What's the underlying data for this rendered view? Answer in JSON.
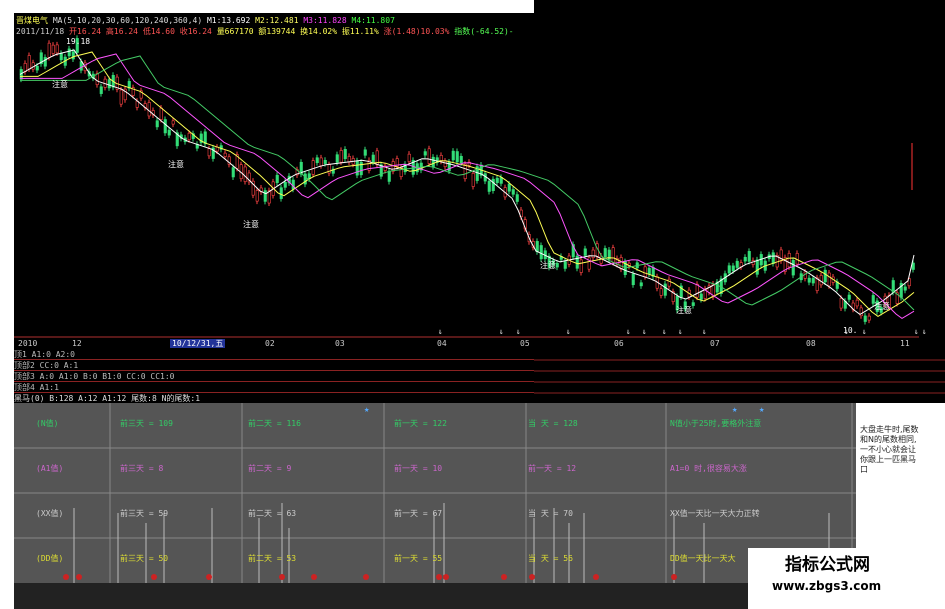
{
  "header": {
    "line1": {
      "name": "晋煤电气",
      "ma": "MA(5,10,20,30,60,120,240,360,4)",
      "m1": "M1:13.692",
      "m2": "M2:12.481",
      "m3": "M3:11.828",
      "m4": "M4:11.807"
    },
    "line2": {
      "date": "2011/11/18",
      "open": "开16.24",
      "high": "高16.24",
      "low": "低14.60",
      "close": "收16.24",
      "vol": "量667170",
      "amt": "额139744",
      "chg": "换14.02%",
      "amp": "振11.11%",
      "rise": "涨(1.48)10.03%",
      "index": "指数(-64.52)-"
    }
  },
  "chart_labels": {
    "price_high": "19.18",
    "price_low": "10.",
    "marks": [
      "注意",
      "注意",
      "注意",
      "注意",
      "注意",
      "注意"
    ]
  },
  "time_axis": {
    "labels": [
      "2010",
      "12",
      "10/12/31,五",
      "02",
      "03",
      "04",
      "05",
      "06",
      "07",
      "08",
      "11"
    ]
  },
  "indicators": [
    "顶1 A1:0 A2:0",
    "顶部2 CC:0 A:1",
    "顶部3 A:0 A1:0 B:0 B1:0 CC:0 CC1:0",
    "顶部4 A1:1",
    "黑马(0) B:128 A:12 A1:12 尾数:8 N的尾数:1"
  ],
  "table": {
    "rows": [
      {
        "head": "(N值)",
        "c1": "前三天 = 109",
        "c2": "前二天 = 116",
        "c3": "前一天 = 122",
        "c4": "当 天 = 128",
        "note": "N值小于25时,要格外注意",
        "color": "#33cc66"
      },
      {
        "head": "(A1值)",
        "c1": "前三天 = 8",
        "c2": "前二天 = 9",
        "c3": "前一天 = 10",
        "c4": "前一天 = 12",
        "note": "A1=0 时,很容易大涨",
        "color": "#cc66cc"
      },
      {
        "head": "(XX值)",
        "c1": "前三天 = 59",
        "c2": "前二天 = 63",
        "c3": "前一天 = 67",
        "c4": "当 天 = 70",
        "note": "XX值一天比一天大力正转",
        "color": "#cccccc"
      },
      {
        "head": "(DD值)",
        "c1": "前三天 = 50",
        "c2": "前二天 = 53",
        "c3": "前一天 = 55",
        "c4": "当 天 = 56",
        "note": "DD值一天比一天大",
        "color": "#dddd33"
      }
    ]
  },
  "side_note": "大盘走牛时,尾数和N的尾数相同,一不小心就会让你跟上一匹黑马口",
  "watermark": {
    "title": "指标公式网",
    "url": "www.zbgs3.com"
  }
}
